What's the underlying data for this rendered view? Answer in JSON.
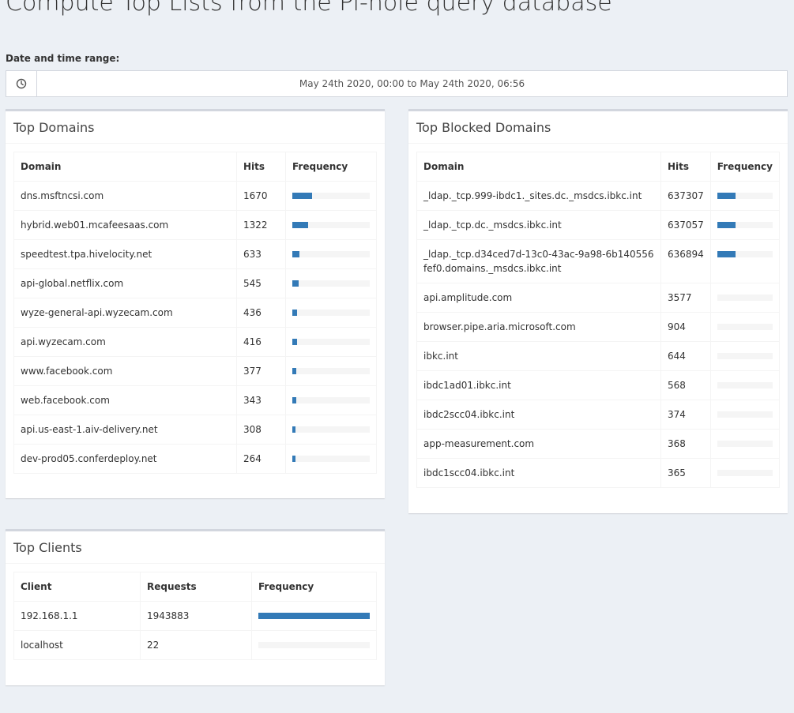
{
  "page_title": "Compute Top Lists from the Pi-hole query database",
  "date_range": {
    "label": "Date and time range:",
    "icon": "clock-icon",
    "value": "May 24th 2020, 00:00 to May 24th 2020, 06:56"
  },
  "colors": {
    "bar": "#337ab7",
    "track": "#f5f5f5",
    "background": "#ecf0f5"
  },
  "top_domains": {
    "title": "Top Domains",
    "headers": [
      "Domain",
      "Hits",
      "Frequency"
    ],
    "rows": [
      {
        "domain": "dns.msftncsi.com",
        "hits": "1670",
        "freq": 0.25
      },
      {
        "domain": "hybrid.web01.mcafeesaas.com",
        "hits": "1322",
        "freq": 0.2
      },
      {
        "domain": "speedtest.tpa.hivelocity.net",
        "hits": "633",
        "freq": 0.09
      },
      {
        "domain": "api-global.netflix.com",
        "hits": "545",
        "freq": 0.08
      },
      {
        "domain": "wyze-general-api.wyzecam.com",
        "hits": "436",
        "freq": 0.06
      },
      {
        "domain": "api.wyzecam.com",
        "hits": "416",
        "freq": 0.06
      },
      {
        "domain": "www.facebook.com",
        "hits": "377",
        "freq": 0.05
      },
      {
        "domain": "web.facebook.com",
        "hits": "343",
        "freq": 0.05
      },
      {
        "domain": "api.us-east-1.aiv-delivery.net",
        "hits": "308",
        "freq": 0.04
      },
      {
        "domain": "dev-prod05.conferdeploy.net",
        "hits": "264",
        "freq": 0.04
      }
    ]
  },
  "top_blocked": {
    "title": "Top Blocked Domains",
    "headers": [
      "Domain",
      "Hits",
      "Frequency"
    ],
    "rows": [
      {
        "domain": "_ldap._tcp.999-ibdc1._sites.dc._msdcs.ibkc.int",
        "hits": "637307",
        "freq": 0.33
      },
      {
        "domain": "_ldap._tcp.dc._msdcs.ibkc.int",
        "hits": "637057",
        "freq": 0.33
      },
      {
        "domain": "_ldap._tcp.d34ced7d-13c0-43ac-9a98-6b140556fef0.domains._msdcs.ibkc.int",
        "hits": "636894",
        "freq": 0.33
      },
      {
        "domain": "api.amplitude.com",
        "hits": "3577",
        "freq": 0
      },
      {
        "domain": "browser.pipe.aria.microsoft.com",
        "hits": "904",
        "freq": 0
      },
      {
        "domain": "ibkc.int",
        "hits": "644",
        "freq": 0
      },
      {
        "domain": "ibdc1ad01.ibkc.int",
        "hits": "568",
        "freq": 0
      },
      {
        "domain": "ibdc2scc04.ibkc.int",
        "hits": "374",
        "freq": 0
      },
      {
        "domain": "app-measurement.com",
        "hits": "368",
        "freq": 0
      },
      {
        "domain": "ibdc1scc04.ibkc.int",
        "hits": "365",
        "freq": 0
      }
    ]
  },
  "top_clients": {
    "title": "Top Clients",
    "headers": [
      "Client",
      "Requests",
      "Frequency"
    ],
    "rows": [
      {
        "client": "192.168.1.1",
        "requests": "1943883",
        "freq": 1.0
      },
      {
        "client": "localhost",
        "requests": "22",
        "freq": 0
      }
    ]
  }
}
